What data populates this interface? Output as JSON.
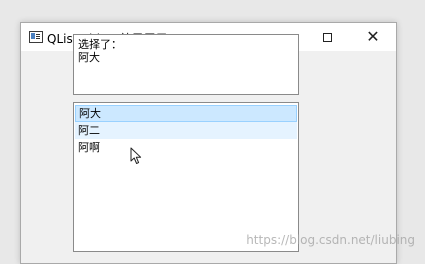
{
  "window": {
    "title": "QListWidget效果展示",
    "icon": "app-window-icon",
    "controls": {
      "minimize_icon": "minimize-icon",
      "maximize_icon": "maximize-icon",
      "close_icon": "close-icon",
      "close_glyph": "✕"
    }
  },
  "label": {
    "line1": "选择了：",
    "line2": "阿大"
  },
  "list": {
    "items": [
      {
        "text": "阿大",
        "state": "selected"
      },
      {
        "text": "阿二",
        "state": "hover"
      },
      {
        "text": "阿啊",
        "state": "normal"
      }
    ],
    "colors": {
      "selected_bg": "#cce8ff",
      "selected_border": "#99d1ff",
      "hover_bg": "#e5f3ff"
    }
  },
  "watermark": "https://blog.csdn.net/liubing"
}
